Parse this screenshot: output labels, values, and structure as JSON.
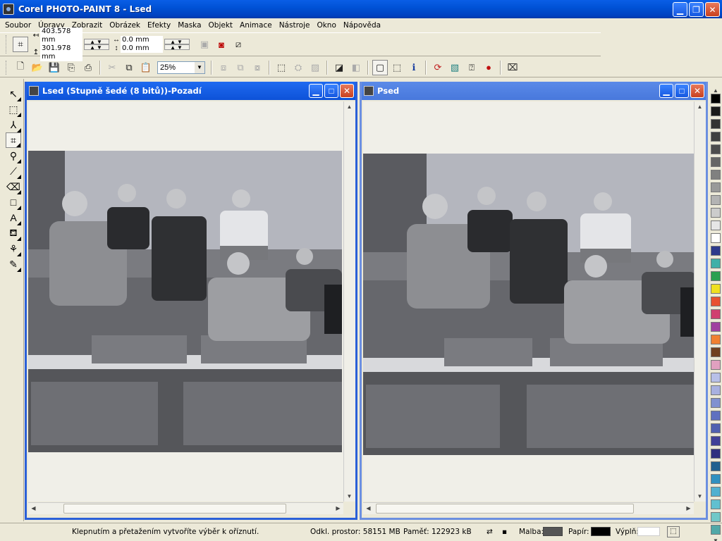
{
  "app": {
    "title": "Corel PHOTO-PAINT 8 - Lsed"
  },
  "menu": [
    "Soubor",
    "Úpravy",
    "Zobrazit",
    "Obrázek",
    "Efekty",
    "Maska",
    "Objekt",
    "Animace",
    "Nástroje",
    "Okno",
    "Nápověda"
  ],
  "property_bar": {
    "width_value": "403.578 mm",
    "height_value": "301.978 mm",
    "offset_x_value": "0.0 mm",
    "offset_y_value": "0.0 mm"
  },
  "toolbar": {
    "zoom_value": "25%"
  },
  "tools": [
    "pick-tool-icon",
    "rectangle-mask-icon",
    "freehand-mask-icon",
    "crop-tool-icon",
    "zoom-tool-icon",
    "eyedropper-icon",
    "eraser-icon",
    "rectangle-shape-icon",
    "text-tool-icon",
    "fill-tool-icon",
    "effect-tool-icon",
    "clone-tool-icon"
  ],
  "documents": [
    {
      "title": "Lsed  (Stupně šedé (8 bitů))-Pozadí"
    },
    {
      "title": "Psed"
    }
  ],
  "palette": [
    "#000000",
    "#1a1a1a",
    "#333333",
    "#404040",
    "#4d4d4d",
    "#666666",
    "#808080",
    "#999999",
    "#b3b3b3",
    "#cccccc",
    "#e6e6e6",
    "#ffffff",
    "#2d3a8c",
    "#40b0a8",
    "#2aa050",
    "#f0e020",
    "#e85030",
    "#d04070",
    "#a040a0",
    "#f08030",
    "#704020",
    "#e0a0c0",
    "#b8c0e8",
    "#a8b0e0",
    "#8090d0",
    "#6070c0",
    "#5060b0",
    "#404098",
    "#303080",
    "#206090",
    "#3090c0",
    "#50b0d0",
    "#60c0d0",
    "#70c8c8",
    "#50a8a8"
  ],
  "status": {
    "hint": "Klepnutím a přetažením vytvoříte výběr k oříznutí.",
    "disk": "Odkl. prostor: 58151 MB",
    "memory": "Paměť: 122923 kB",
    "paint_label": "Malba:",
    "paper_label": "Papír:",
    "fill_label": "Výplň:",
    "paint_color": "#555555",
    "paper_color": "#000000",
    "fill_color": "#ffffff"
  }
}
